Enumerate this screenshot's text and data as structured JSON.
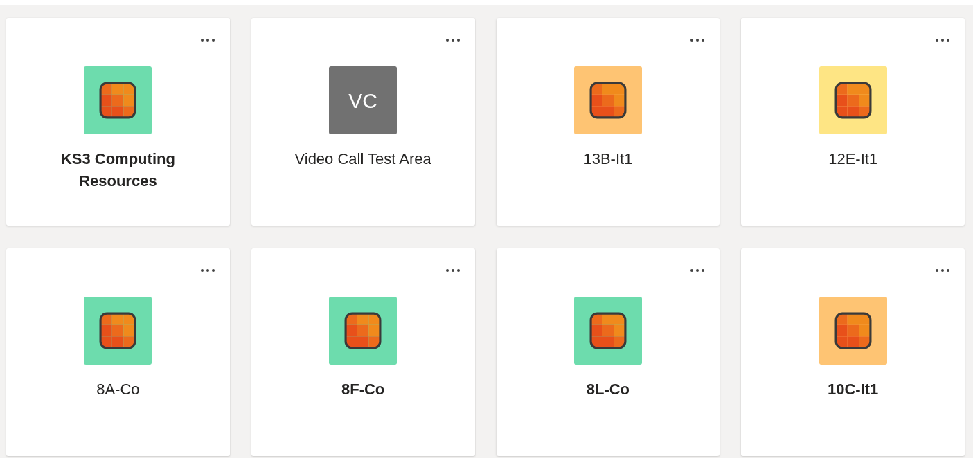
{
  "teams": [
    {
      "name": "KS3 Computing Resources",
      "unread": true,
      "tile": {
        "kind": "icon",
        "color": "#6ddcad"
      }
    },
    {
      "name": "Video Call Test Area",
      "unread": false,
      "tile": {
        "kind": "initials",
        "initials": "VC",
        "color": "#717171"
      }
    },
    {
      "name": "13B-It1",
      "unread": false,
      "tile": {
        "kind": "icon",
        "color": "#fec473"
      }
    },
    {
      "name": "12E-It1",
      "unread": false,
      "tile": {
        "kind": "icon",
        "color": "#fee584"
      }
    },
    {
      "name": "8A-Co",
      "unread": false,
      "tile": {
        "kind": "icon",
        "color": "#6ddcad"
      }
    },
    {
      "name": "8F-Co",
      "unread": true,
      "tile": {
        "kind": "icon",
        "color": "#6ddcad"
      }
    },
    {
      "name": "8L-Co",
      "unread": true,
      "tile": {
        "kind": "icon",
        "color": "#6ddcad"
      }
    },
    {
      "name": "10C-It1",
      "unread": true,
      "tile": {
        "kind": "icon",
        "color": "#fec473"
      }
    }
  ]
}
